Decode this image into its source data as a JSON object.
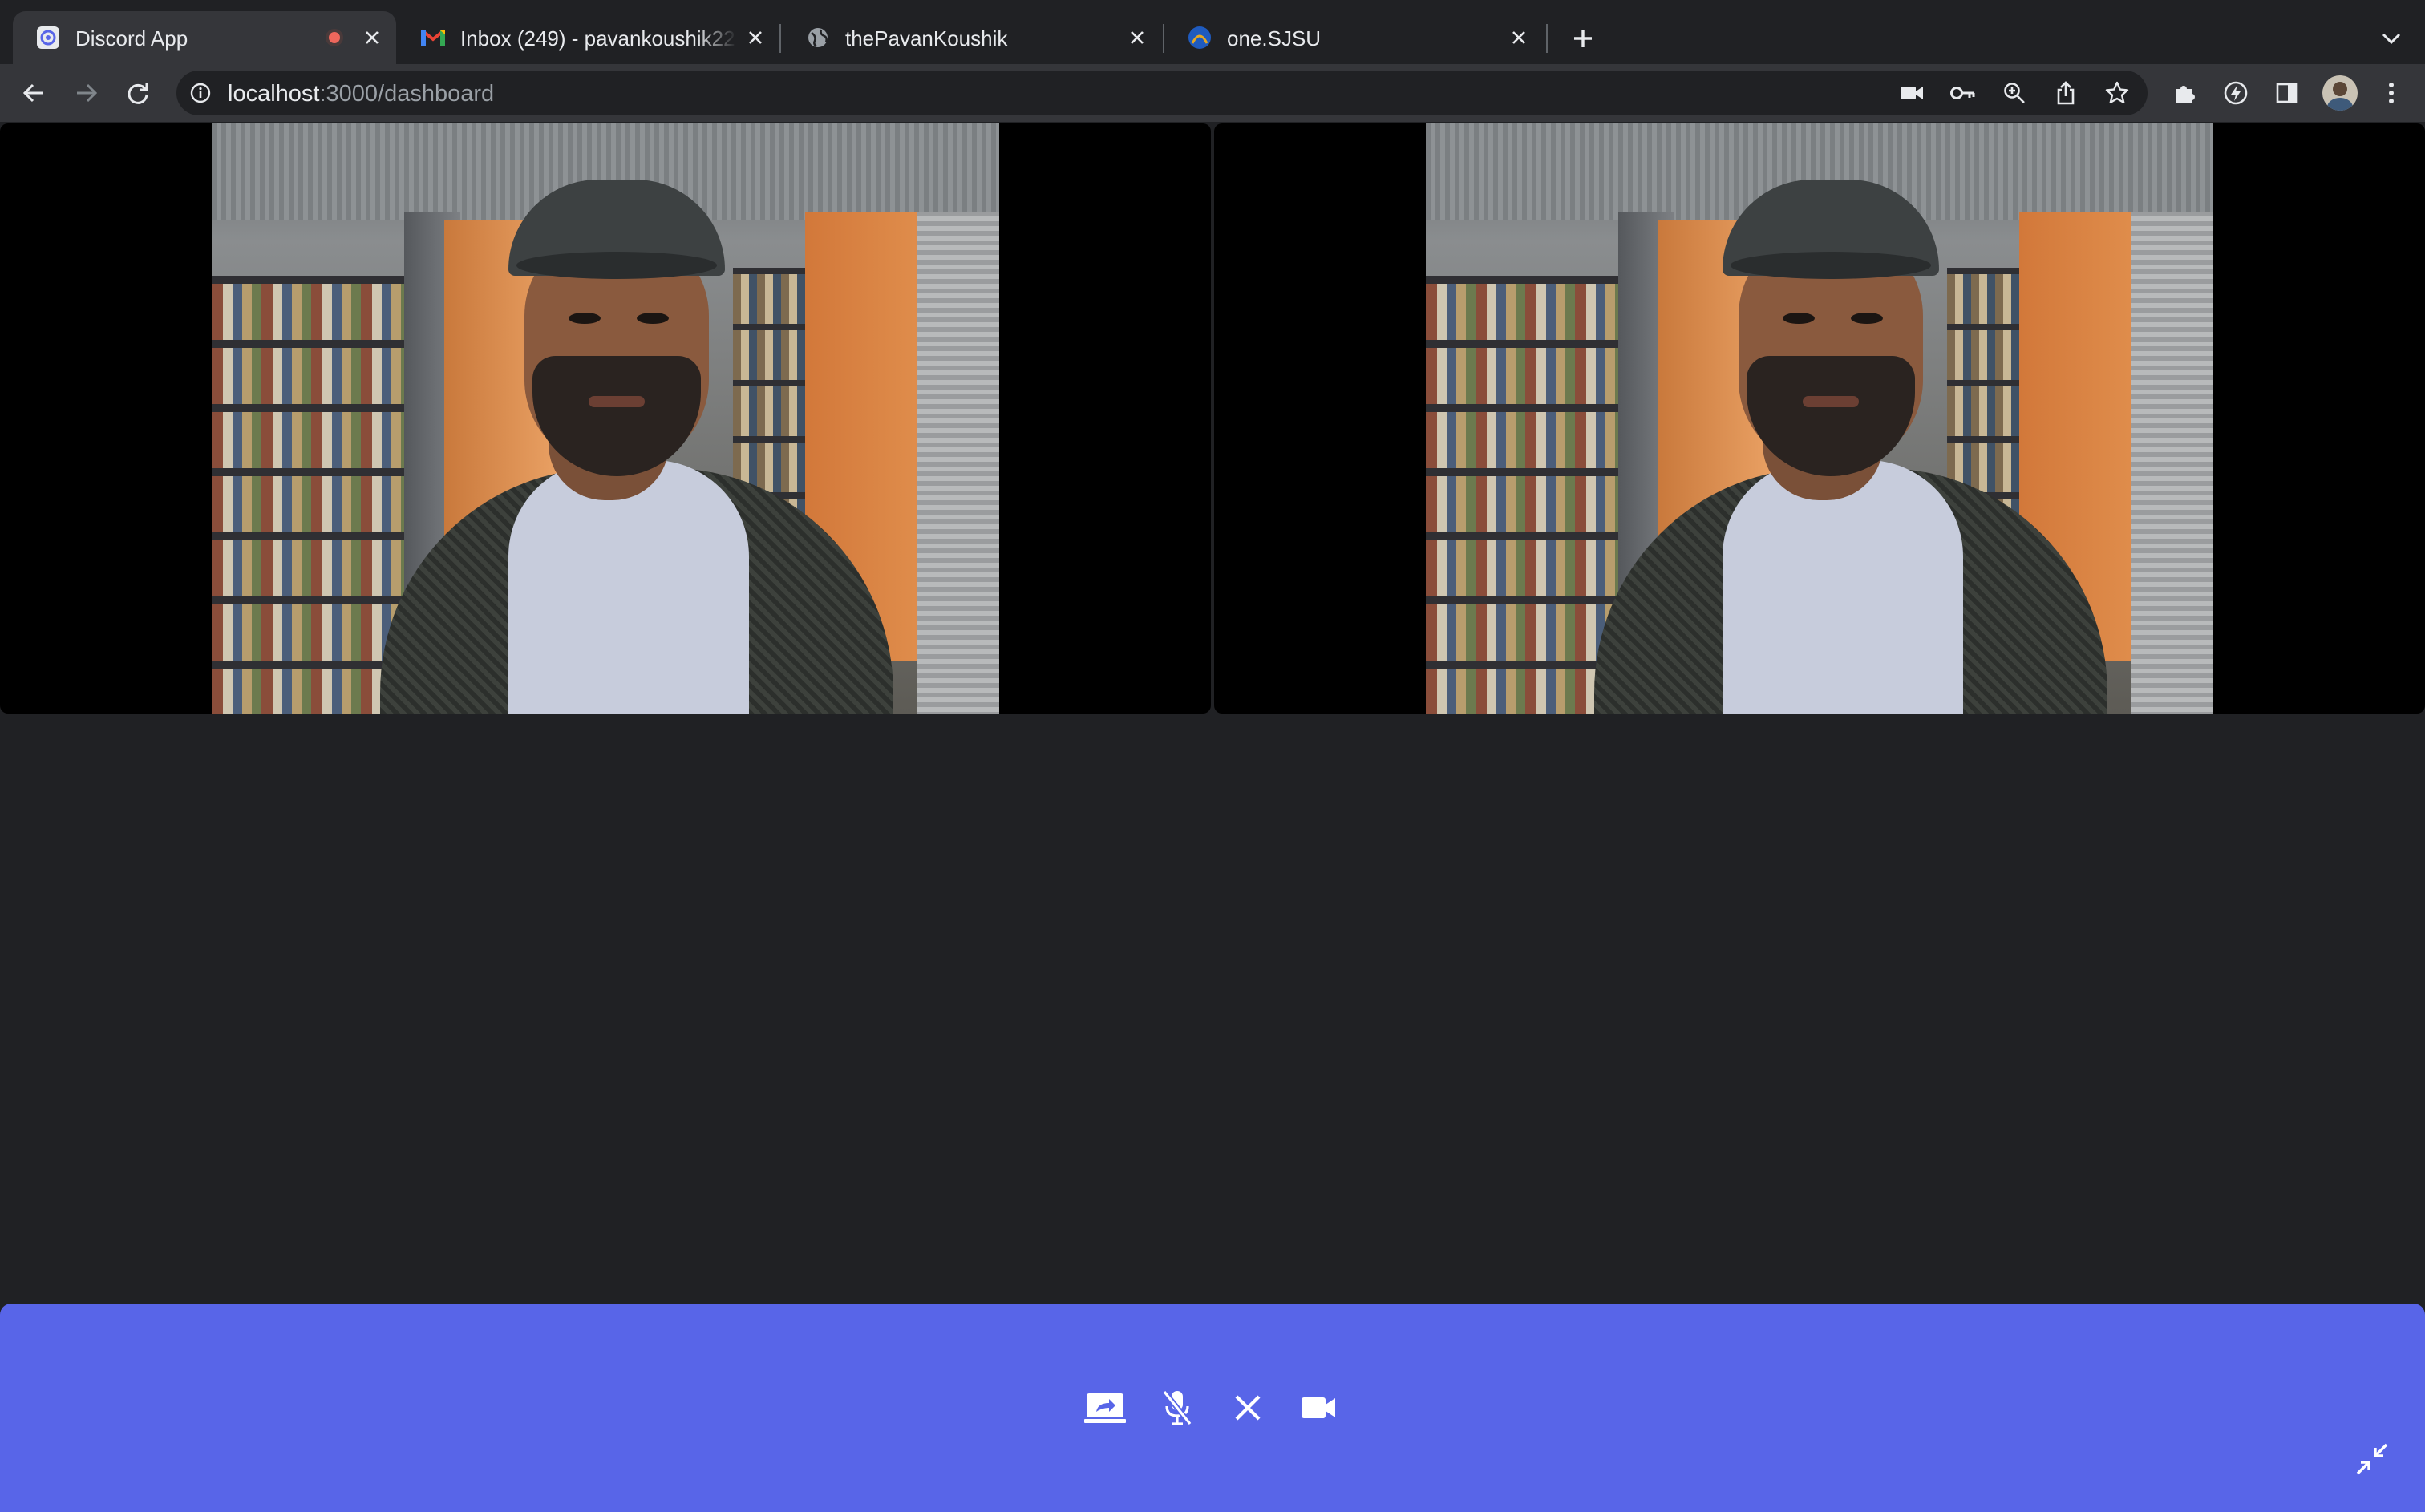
{
  "browser": {
    "tabs": [
      {
        "title": "Discord App",
        "icon": "discord-app-icon",
        "recording": true,
        "active": true
      },
      {
        "title": "Inbox (249) - pavankoushik22@",
        "icon": "gmail-icon",
        "active": false
      },
      {
        "title": "thePavanKoushik",
        "icon": "globe-icon",
        "active": false
      },
      {
        "title": "one.SJSU",
        "icon": "sjsu-icon",
        "active": false
      }
    ],
    "url": {
      "host": "localhost",
      "path": ":3000/dashboard"
    }
  },
  "call": {
    "participants": [
      {
        "name": "local-video"
      },
      {
        "name": "remote-video"
      }
    ],
    "controls": [
      {
        "name": "screen-share-button",
        "icon": "screen-share-icon"
      },
      {
        "name": "mute-button",
        "icon": "microphone-off-icon"
      },
      {
        "name": "leave-call-button",
        "icon": "close-icon"
      },
      {
        "name": "camera-button",
        "icon": "video-camera-icon"
      }
    ],
    "minimize_icon": "minimize-icon"
  },
  "colors": {
    "tabstrip": "#202124",
    "toolbar": "#35363a",
    "content": "#202124",
    "controls_bar": "#5865e8",
    "recording_dot": "#ee675c"
  }
}
